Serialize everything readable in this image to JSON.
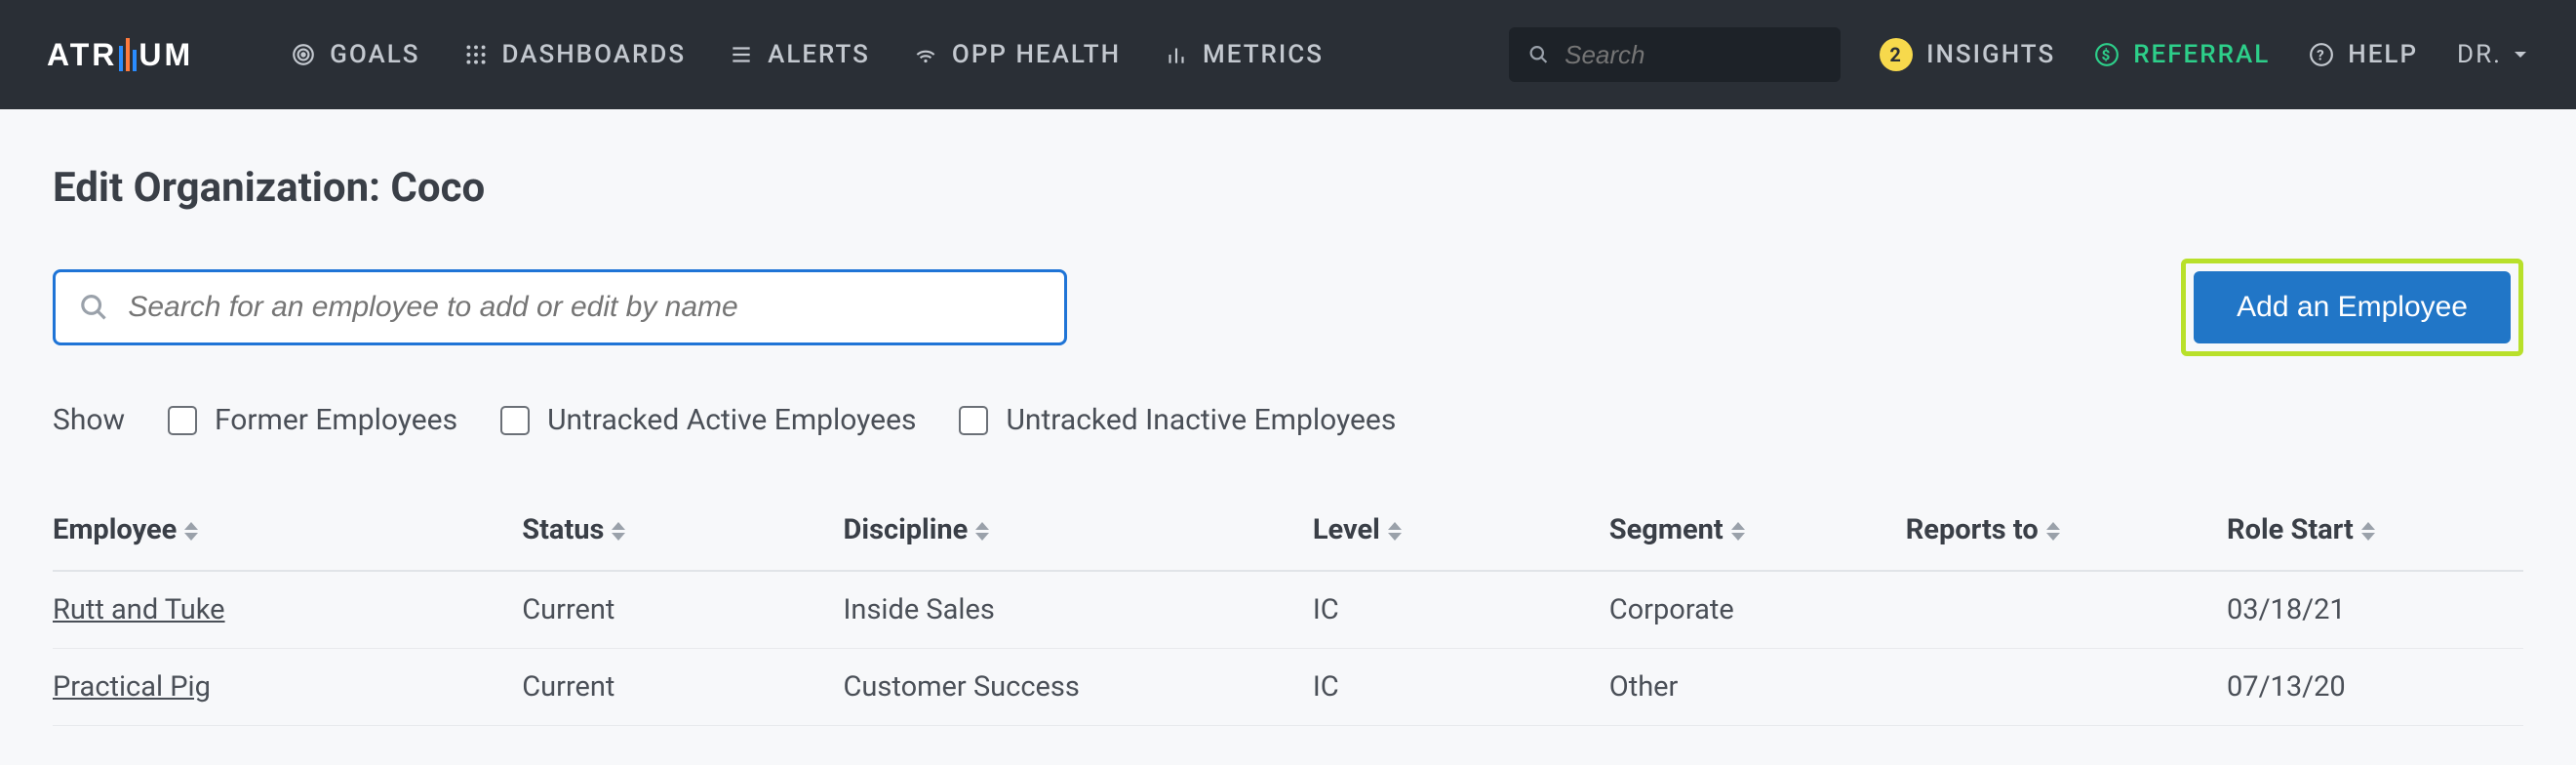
{
  "brand": {
    "part1": "ATR",
    "part2": "UM"
  },
  "nav": {
    "goals": "GOALS",
    "dashboards": "DASHBOARDS",
    "alerts": "ALERTS",
    "opp_health": "OPP HEALTH",
    "metrics": "METRICS"
  },
  "search": {
    "placeholder": "Search"
  },
  "right": {
    "insights_count": "2",
    "insights": "INSIGHTS",
    "referral": "REFERRAL",
    "help": "HELP",
    "user": "DR."
  },
  "page": {
    "title": "Edit Organization: Coco"
  },
  "emp_search": {
    "placeholder": "Search for an employee to add or edit by name"
  },
  "add_button": "Add an Employee",
  "filters": {
    "label": "Show",
    "former": "Former Employees",
    "untracked_active": "Untracked Active Employees",
    "untracked_inactive": "Untracked Inactive Employees"
  },
  "table": {
    "headers": {
      "employee": "Employee",
      "status": "Status",
      "discipline": "Discipline",
      "level": "Level",
      "segment": "Segment",
      "reports_to": "Reports to",
      "role_start": "Role Start"
    },
    "rows": [
      {
        "employee": "Rutt and Tuke",
        "status": "Current",
        "discipline": "Inside Sales",
        "level": "IC",
        "segment": "Corporate",
        "reports_to": "",
        "role_start": "03/18/21"
      },
      {
        "employee": "Practical Pig",
        "status": "Current",
        "discipline": "Customer Success",
        "level": "IC",
        "segment": "Other",
        "reports_to": "",
        "role_start": "07/13/20"
      }
    ]
  }
}
